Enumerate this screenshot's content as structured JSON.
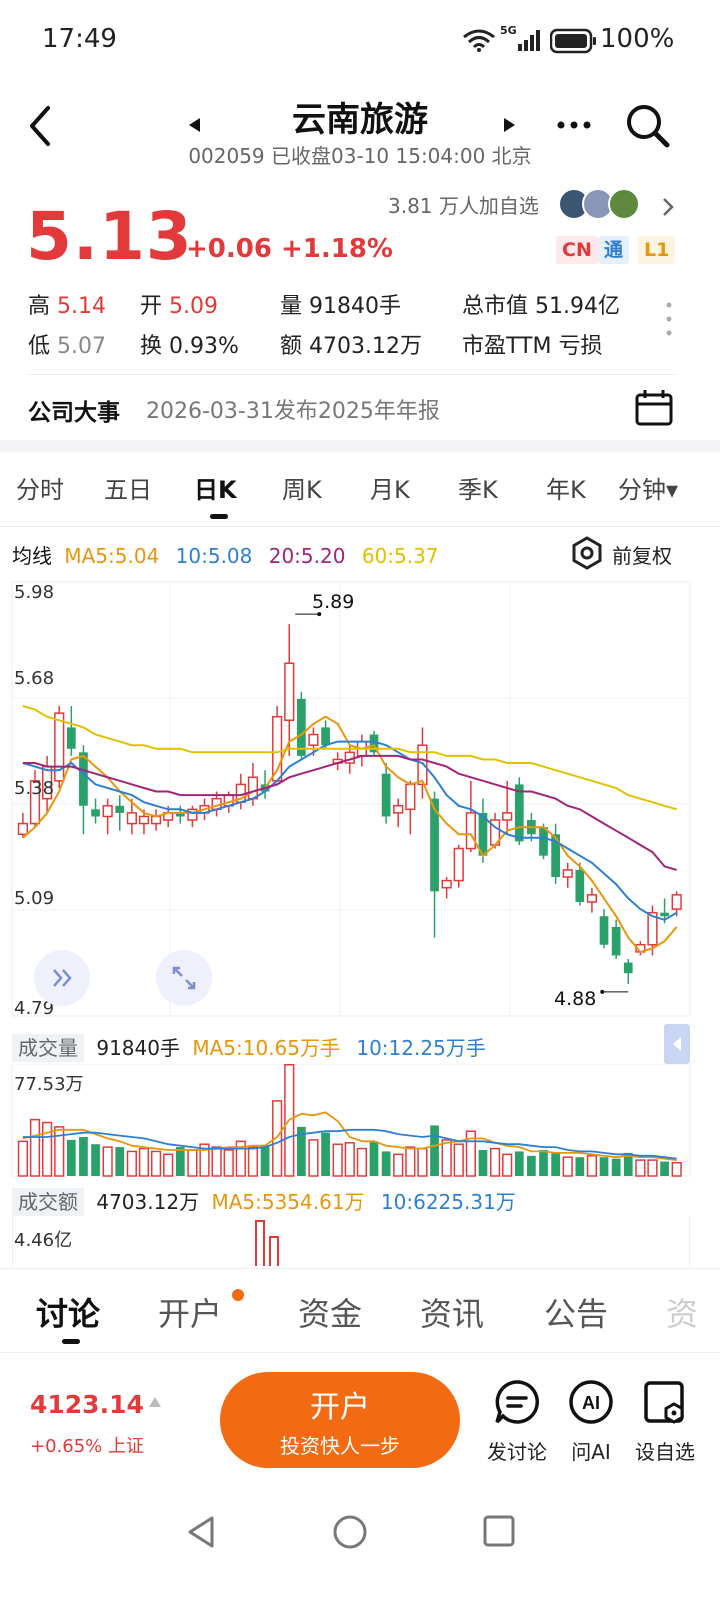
{
  "status_bar": {
    "time": "17:49",
    "network": "5G",
    "battery": "100%"
  },
  "header": {
    "title": "云南旅游",
    "subtitle": "002059 已收盘03-10 15:04:00 北京"
  },
  "quote": {
    "price": "5.13",
    "change": "+0.06 +1.18%",
    "followers": "3.81 万人加自选",
    "tags": [
      "CN",
      "通",
      "L1"
    ],
    "colors": {
      "up": "#e23a3a",
      "down": "#2aa06a"
    }
  },
  "stats": {
    "high_label": "高",
    "high": "5.14",
    "open_label": "开",
    "open": "5.09",
    "vol_label": "量",
    "vol": "91840手",
    "mcap_label": "总市值",
    "mcap": "51.94亿",
    "low_label": "低",
    "low": "5.07",
    "turn_label": "换",
    "turn": "0.93%",
    "amt_label": "额",
    "amt": "4703.12万",
    "pe_label": "市盈TTM",
    "pe": "亏损"
  },
  "event": {
    "label": "公司大事",
    "text": "2026-03-31发布2025年年报"
  },
  "period_tabs": [
    "分时",
    "五日",
    "日K",
    "周K",
    "月K",
    "季K",
    "年K",
    "分钟▾"
  ],
  "ma_legend": {
    "label": "均线",
    "ma5": "MA5:5.04",
    "ma10": "10:5.08",
    "ma20": "20:5.20",
    "ma60": "60:5.37",
    "adjust": "前复权"
  },
  "price_axis": [
    "5.98",
    "5.68",
    "5.38",
    "5.09",
    "4.79"
  ],
  "annotations": {
    "high_mark": "5.89",
    "low_mark": "4.88"
  },
  "volume_legend": {
    "label": "成交量",
    "value": "91840手",
    "ma5": "MA5:10.65万手",
    "ma10": "10:12.25万手",
    "axis_max": "77.53万"
  },
  "amount_legend": {
    "label": "成交额",
    "value": "4703.12万",
    "ma5": "MA5:5354.61万",
    "ma10": "10:6225.31万",
    "axis_max": "4.46亿"
  },
  "bottom_tabs": [
    "讨论",
    "开户",
    "资金",
    "资讯",
    "公告",
    "资"
  ],
  "index": {
    "value": "4123.14",
    "change": "+0.65% 上证"
  },
  "open_account": {
    "title": "开户",
    "subtitle": "投资快人一步"
  },
  "actions": [
    "发讨论",
    "问AI",
    "设自选"
  ],
  "chart_data": {
    "type": "candlestick",
    "ylim": [
      4.79,
      5.98
    ],
    "candles": [
      {
        "o": 5.3,
        "h": 5.36,
        "l": 5.29,
        "c": 5.33
      },
      {
        "o": 5.33,
        "h": 5.48,
        "l": 5.32,
        "c": 5.45
      },
      {
        "o": 5.4,
        "h": 5.52,
        "l": 5.36,
        "c": 5.49
      },
      {
        "o": 5.45,
        "h": 5.66,
        "l": 5.43,
        "c": 5.64
      },
      {
        "o": 5.6,
        "h": 5.66,
        "l": 5.52,
        "c": 5.54
      },
      {
        "o": 5.53,
        "h": 5.55,
        "l": 5.3,
        "c": 5.38
      },
      {
        "o": 5.37,
        "h": 5.4,
        "l": 5.33,
        "c": 5.35
      },
      {
        "o": 5.35,
        "h": 5.4,
        "l": 5.3,
        "c": 5.38
      },
      {
        "o": 5.38,
        "h": 5.41,
        "l": 5.31,
        "c": 5.36
      },
      {
        "o": 5.33,
        "h": 5.4,
        "l": 5.3,
        "c": 5.36
      },
      {
        "o": 5.33,
        "h": 5.37,
        "l": 5.3,
        "c": 5.35
      },
      {
        "o": 5.33,
        "h": 5.37,
        "l": 5.31,
        "c": 5.35
      },
      {
        "o": 5.34,
        "h": 5.38,
        "l": 5.32,
        "c": 5.36
      },
      {
        "o": 5.36,
        "h": 5.38,
        "l": 5.33,
        "c": 5.35
      },
      {
        "o": 5.34,
        "h": 5.38,
        "l": 5.32,
        "c": 5.37
      },
      {
        "o": 5.36,
        "h": 5.4,
        "l": 5.34,
        "c": 5.38
      },
      {
        "o": 5.37,
        "h": 5.42,
        "l": 5.35,
        "c": 5.4
      },
      {
        "o": 5.38,
        "h": 5.42,
        "l": 5.36,
        "c": 5.41
      },
      {
        "o": 5.39,
        "h": 5.47,
        "l": 5.37,
        "c": 5.44
      },
      {
        "o": 5.4,
        "h": 5.5,
        "l": 5.38,
        "c": 5.46
      },
      {
        "o": 5.44,
        "h": 5.48,
        "l": 5.4,
        "c": 5.42
      },
      {
        "o": 5.45,
        "h": 5.66,
        "l": 5.45,
        "c": 5.63
      },
      {
        "o": 5.62,
        "h": 5.89,
        "l": 5.52,
        "c": 5.78
      },
      {
        "o": 5.68,
        "h": 5.7,
        "l": 5.51,
        "c": 5.52
      },
      {
        "o": 5.55,
        "h": 5.6,
        "l": 5.52,
        "c": 5.58
      },
      {
        "o": 5.6,
        "h": 5.62,
        "l": 5.54,
        "c": 5.55
      },
      {
        "o": 5.5,
        "h": 5.53,
        "l": 5.48,
        "c": 5.51
      },
      {
        "o": 5.5,
        "h": 5.55,
        "l": 5.47,
        "c": 5.53
      },
      {
        "o": 5.52,
        "h": 5.58,
        "l": 5.49,
        "c": 5.56
      },
      {
        "o": 5.58,
        "h": 5.59,
        "l": 5.52,
        "c": 5.53
      },
      {
        "o": 5.47,
        "h": 5.5,
        "l": 5.33,
        "c": 5.35
      },
      {
        "o": 5.36,
        "h": 5.4,
        "l": 5.32,
        "c": 5.38
      },
      {
        "o": 5.37,
        "h": 5.45,
        "l": 5.3,
        "c": 5.44
      },
      {
        "o": 5.44,
        "h": 5.6,
        "l": 5.4,
        "c": 5.55
      },
      {
        "o": 5.4,
        "h": 5.42,
        "l": 5.01,
        "c": 5.14
      },
      {
        "o": 5.15,
        "h": 5.18,
        "l": 5.12,
        "c": 5.17
      },
      {
        "o": 5.17,
        "h": 5.27,
        "l": 5.15,
        "c": 5.26
      },
      {
        "o": 5.26,
        "h": 5.45,
        "l": 5.25,
        "c": 5.36
      },
      {
        "o": 5.36,
        "h": 5.4,
        "l": 5.22,
        "c": 5.24
      },
      {
        "o": 5.27,
        "h": 5.36,
        "l": 5.26,
        "c": 5.34
      },
      {
        "o": 5.34,
        "h": 5.45,
        "l": 5.3,
        "c": 5.36
      },
      {
        "o": 5.44,
        "h": 5.46,
        "l": 5.27,
        "c": 5.28
      },
      {
        "o": 5.34,
        "h": 5.36,
        "l": 5.28,
        "c": 5.3
      },
      {
        "o": 5.32,
        "h": 5.33,
        "l": 5.23,
        "c": 5.24
      },
      {
        "o": 5.3,
        "h": 5.33,
        "l": 5.16,
        "c": 5.18
      },
      {
        "o": 5.18,
        "h": 5.22,
        "l": 5.15,
        "c": 5.2
      },
      {
        "o": 5.2,
        "h": 5.22,
        "l": 5.1,
        "c": 5.11
      },
      {
        "o": 5.11,
        "h": 5.15,
        "l": 5.08,
        "c": 5.13
      },
      {
        "o": 5.07,
        "h": 5.09,
        "l": 4.98,
        "c": 4.99
      },
      {
        "o": 5.04,
        "h": 5.06,
        "l": 4.95,
        "c": 4.96
      },
      {
        "o": 4.94,
        "h": 4.95,
        "l": 4.88,
        "c": 4.91
      },
      {
        "o": 4.97,
        "h": 5.0,
        "l": 4.96,
        "c": 4.99
      },
      {
        "o": 4.99,
        "h": 5.1,
        "l": 4.96,
        "c": 5.08
      },
      {
        "o": 5.08,
        "h": 5.12,
        "l": 5.05,
        "c": 5.07
      },
      {
        "o": 5.09,
        "h": 5.14,
        "l": 5.07,
        "c": 5.13
      }
    ],
    "ma_series": [
      {
        "name": "MA5",
        "color": "#e8960c",
        "values": [
          5.29,
          5.32,
          5.36,
          5.42,
          5.51,
          5.52,
          5.49,
          5.46,
          5.42,
          5.39,
          5.36,
          5.35,
          5.36,
          5.36,
          5.36,
          5.37,
          5.38,
          5.39,
          5.4,
          5.42,
          5.43,
          5.48,
          5.56,
          5.58,
          5.61,
          5.63,
          5.61,
          5.55,
          5.54,
          5.55,
          5.49,
          5.46,
          5.44,
          5.45,
          5.37,
          5.33,
          5.3,
          5.3,
          5.24,
          5.27,
          5.31,
          5.32,
          5.32,
          5.32,
          5.29,
          5.24,
          5.21,
          5.17,
          5.12,
          5.07,
          5.01,
          4.97,
          4.98,
          5.0,
          5.04
        ]
      },
      {
        "name": "10",
        "color": "#2f7fd1",
        "values": [
          5.5,
          5.49,
          5.48,
          5.48,
          5.5,
          5.47,
          5.44,
          5.43,
          5.42,
          5.41,
          5.39,
          5.38,
          5.37,
          5.37,
          5.36,
          5.36,
          5.37,
          5.38,
          5.39,
          5.4,
          5.42,
          5.45,
          5.49,
          5.51,
          5.53,
          5.55,
          5.56,
          5.56,
          5.56,
          5.56,
          5.55,
          5.53,
          5.51,
          5.5,
          5.46,
          5.41,
          5.38,
          5.37,
          5.35,
          5.32,
          5.3,
          5.29,
          5.29,
          5.29,
          5.28,
          5.26,
          5.24,
          5.22,
          5.19,
          5.16,
          5.12,
          5.09,
          5.07,
          5.06,
          5.08
        ]
      },
      {
        "name": "20",
        "color": "#a0257a",
        "values": [
          5.5,
          5.5,
          5.49,
          5.49,
          5.49,
          5.48,
          5.47,
          5.46,
          5.45,
          5.44,
          5.43,
          5.42,
          5.42,
          5.41,
          5.41,
          5.41,
          5.41,
          5.41,
          5.41,
          5.42,
          5.43,
          5.44,
          5.46,
          5.47,
          5.48,
          5.49,
          5.5,
          5.51,
          5.52,
          5.52,
          5.52,
          5.52,
          5.51,
          5.51,
          5.5,
          5.49,
          5.47,
          5.46,
          5.45,
          5.44,
          5.43,
          5.42,
          5.42,
          5.41,
          5.4,
          5.38,
          5.37,
          5.35,
          5.33,
          5.31,
          5.29,
          5.27,
          5.25,
          5.21,
          5.2
        ]
      },
      {
        "name": "60",
        "color": "#e0c000",
        "values": [
          5.66,
          5.65,
          5.63,
          5.62,
          5.61,
          5.6,
          5.58,
          5.57,
          5.56,
          5.55,
          5.55,
          5.54,
          5.54,
          5.54,
          5.53,
          5.53,
          5.53,
          5.53,
          5.53,
          5.53,
          5.53,
          5.53,
          5.54,
          5.54,
          5.54,
          5.54,
          5.54,
          5.54,
          5.54,
          5.54,
          5.54,
          5.54,
          5.53,
          5.53,
          5.53,
          5.52,
          5.52,
          5.52,
          5.51,
          5.51,
          5.5,
          5.5,
          5.5,
          5.49,
          5.48,
          5.47,
          5.46,
          5.45,
          5.44,
          5.43,
          5.41,
          5.4,
          5.39,
          5.38,
          5.37
        ]
      }
    ],
    "volume": [
      24,
      39,
      37,
      34,
      25,
      27,
      22,
      20,
      20,
      17,
      19,
      17,
      15,
      20,
      18,
      22,
      20,
      18,
      24,
      20,
      21,
      52,
      77,
      34,
      25,
      30,
      22,
      23,
      19,
      24,
      17,
      15,
      20,
      19,
      35,
      25,
      22,
      31,
      18,
      19,
      15,
      17,
      14,
      18,
      16,
      13,
      13,
      14,
      13,
      12,
      16,
      11,
      11,
      10,
      9.2
    ],
    "volume_ma5": [
      26,
      28,
      30,
      32,
      32,
      32,
      29,
      26,
      24,
      21,
      20,
      19,
      18,
      18,
      18,
      18,
      19,
      20,
      20,
      21,
      21,
      27,
      39,
      43,
      42,
      44,
      38,
      27,
      24,
      24,
      21,
      20,
      19,
      19,
      21,
      23,
      24,
      26,
      26,
      23,
      21,
      20,
      17,
      17,
      16,
      16,
      16,
      15,
      14,
      13,
      14,
      13,
      13,
      12,
      11
    ],
    "volume_ma10": [
      27,
      27,
      27,
      28,
      29,
      30,
      30,
      29,
      28,
      27,
      26,
      24,
      22,
      21,
      20,
      19,
      19,
      19,
      19,
      19,
      20,
      23,
      27,
      29,
      30,
      31,
      31,
      32,
      32,
      32,
      31,
      29,
      28,
      27,
      28,
      26,
      24,
      24,
      24,
      23,
      22,
      22,
      21,
      20,
      20,
      18,
      17,
      17,
      16,
      15,
      15,
      14,
      14,
      13,
      12
    ],
    "volume_max": 77.53
  }
}
